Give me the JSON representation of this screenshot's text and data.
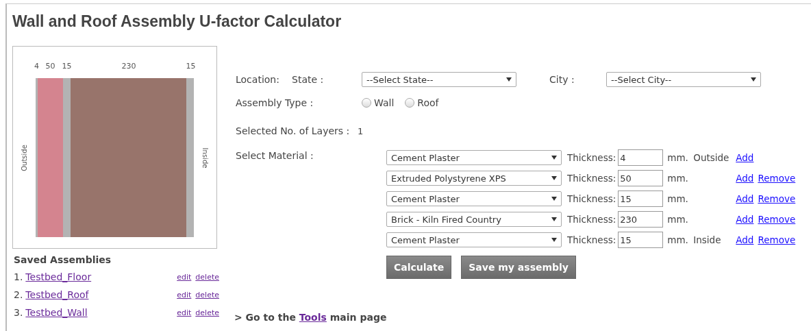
{
  "title": "Wall and Roof Assembly U-factor Calculator",
  "diagram": {
    "outside_label": "Outside",
    "inside_label": "Inside",
    "layers": [
      {
        "label": "4",
        "color": "#b3b3b3"
      },
      {
        "label": "50",
        "color": "#d4848f"
      },
      {
        "label": "15",
        "color": "#b3b3b3"
      },
      {
        "label": "230",
        "color": "#98746b"
      },
      {
        "label": "15",
        "color": "#b3b3b3"
      }
    ]
  },
  "saved": {
    "heading": "Saved Assemblies",
    "items": [
      {
        "number": "1.",
        "name": "Testbed_Floor",
        "edit": "edit",
        "delete": "delete"
      },
      {
        "number": "2.",
        "name": "Testbed_Roof",
        "edit": "edit",
        "delete": "delete"
      },
      {
        "number": "3.",
        "name": "Testbed_Wall",
        "edit": "edit",
        "delete": "delete"
      }
    ]
  },
  "location": {
    "label": "Location:",
    "state_label": "State :",
    "state_value": "--Select State--",
    "city_label": "City :",
    "city_value": "--Select City--"
  },
  "assembly_type": {
    "label": "Assembly Type :",
    "options": [
      {
        "label": "Wall",
        "selected": false
      },
      {
        "label": "Roof",
        "selected": false
      }
    ]
  },
  "layers_count": {
    "label": "Selected No. of Layers :",
    "value": "1"
  },
  "materials": {
    "label": "Select Material :",
    "rows": [
      {
        "material": "Cement Plaster",
        "thickness_label": "Thickness:",
        "thickness": "4",
        "unit": "mm.",
        "side": "Outside",
        "actions": [
          "Add"
        ]
      },
      {
        "material": "Extruded Polystyrene XPS",
        "thickness_label": "Thickness:",
        "thickness": "50",
        "unit": "mm.",
        "actions": [
          "Add",
          "Remove"
        ]
      },
      {
        "material": "Cement Plaster",
        "thickness_label": "Thickness:",
        "thickness": "15",
        "unit": "mm.",
        "actions": [
          "Add",
          "Remove"
        ]
      },
      {
        "material": "Brick - Kiln Fired Country",
        "thickness_label": "Thickness:",
        "thickness": "230",
        "unit": "mm.",
        "actions": [
          "Add",
          "Remove"
        ]
      },
      {
        "material": "Cement Plaster",
        "thickness_label": "Thickness:",
        "thickness": "15",
        "unit": "mm.",
        "side": "Inside",
        "actions": [
          "Add",
          "Remove"
        ]
      }
    ]
  },
  "buttons": [
    "Calculate",
    "Save my assembly"
  ],
  "footer": {
    "prefix": "> Go to the",
    "link": "Tools",
    "suffix": "main page"
  }
}
